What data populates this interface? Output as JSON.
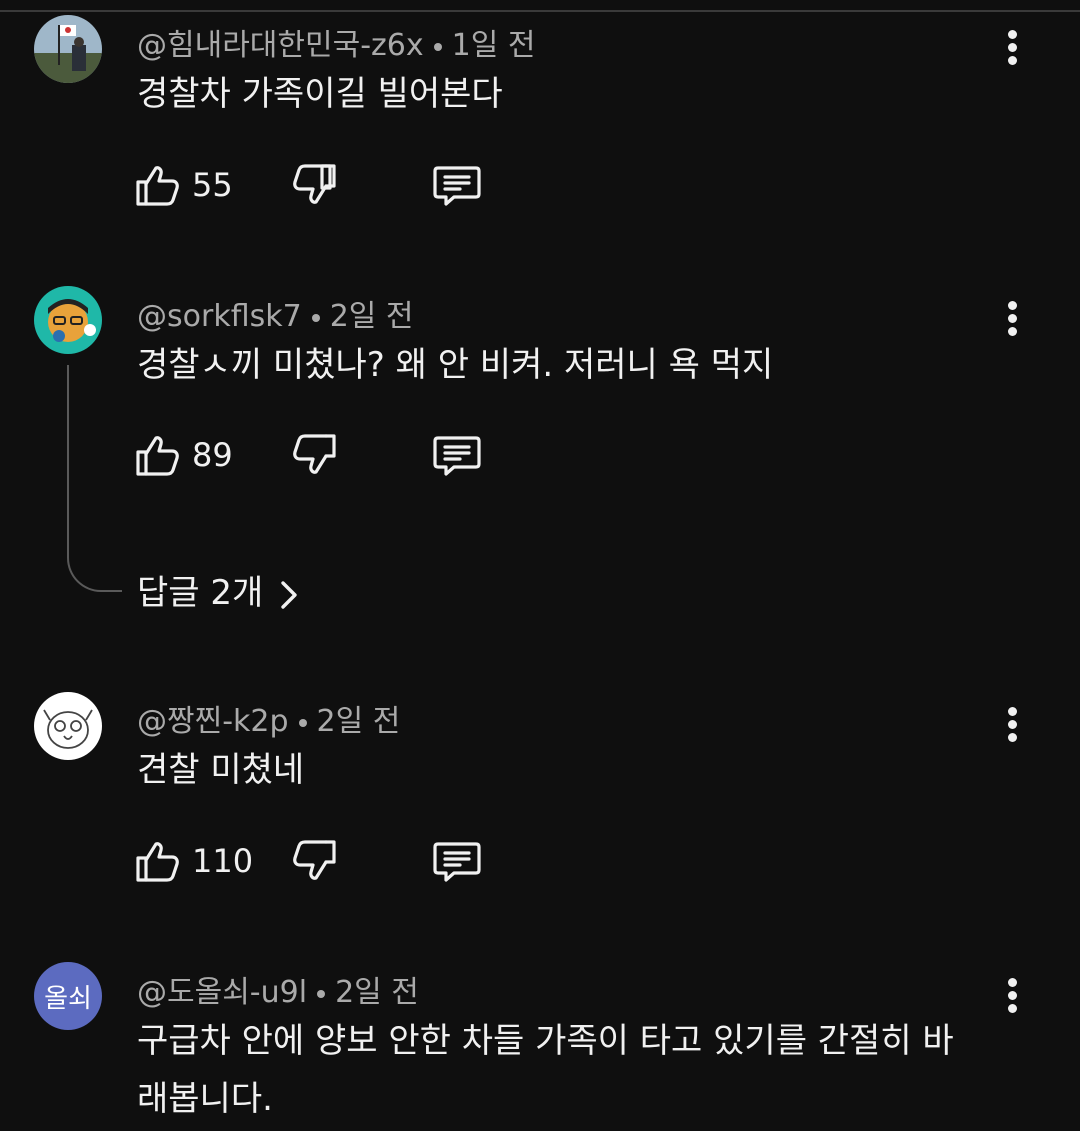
{
  "comments": [
    {
      "author": "@힘내라대한민국-z6x",
      "time": "1일 전",
      "text": "경찰차 가족이길 빌어본다",
      "likes": "55"
    },
    {
      "author": "@sorkflsk7",
      "time": "2일 전",
      "text": "경찰ㅅ끼 미쳤나? 왜 안 비켜. 저러니 욕 먹지",
      "likes": "89",
      "replies_label": "답글 2개"
    },
    {
      "author": "@짱찐-k2p",
      "time": "2일 전",
      "text": "견찰 미쳤네",
      "likes": "110"
    },
    {
      "author": "@도올쇠-u9l",
      "time": "2일 전",
      "text": "구급차 안에 양보 안한 차들 가족이 타고 있기를 간절히 바래봅니다.",
      "avatar_text": "올쇠",
      "avatar_color": "#5c6bc0"
    }
  ],
  "icons": {
    "like": "thumbs-up-icon",
    "dislike": "thumbs-down-icon",
    "reply": "comment-icon",
    "more": "more-vertical-icon",
    "expand": "chevron-right-icon"
  }
}
